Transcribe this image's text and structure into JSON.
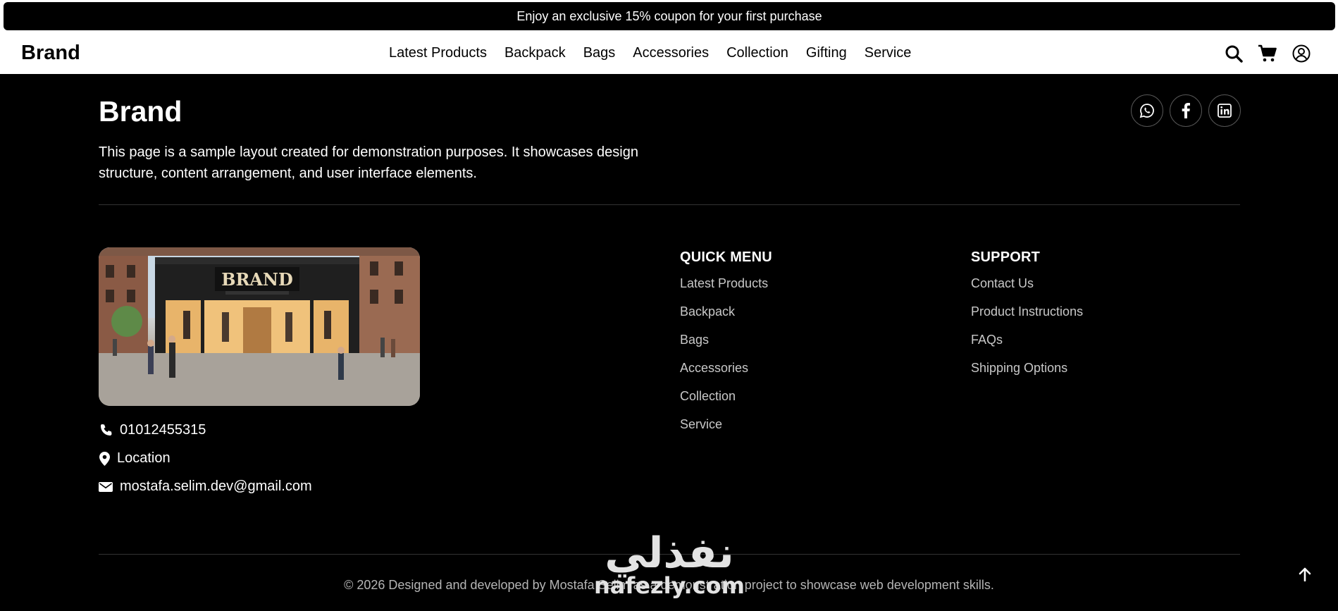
{
  "announcement": {
    "text": "Enjoy an exclusive 15% coupon for your first purchase"
  },
  "navbar": {
    "brand": "Brand",
    "links": [
      "Latest Products",
      "Backpack",
      "Bags",
      "Accessories",
      "Collection",
      "Gifting",
      "Service"
    ],
    "icons": [
      "search-icon",
      "cart-icon",
      "user-circle-icon"
    ]
  },
  "footer": {
    "brand": "Brand",
    "description": "This page is a sample layout created for demonstration purposes. It showcases design structure, content arrangement, and user interface elements.",
    "socials": [
      "whatsapp-icon",
      "facebook-icon",
      "linkedin-icon"
    ],
    "store_sign": "BRAND",
    "contact": {
      "phone": "01012455315",
      "location": "Location",
      "email": "mostafa.selim.dev@gmail.com"
    },
    "quick_menu": {
      "title": "QUICK MENU",
      "items": [
        "Latest Products",
        "Backpack",
        "Bags",
        "Accessories",
        "Collection",
        "Service"
      ]
    },
    "support": {
      "title": "SUPPORT",
      "items": [
        "Contact Us",
        "Product Instructions",
        "FAQs",
        "Shipping Options"
      ]
    },
    "copyright": "© 2026 Designed and developed by Mostafa Selim as a demonstration project to showcase web development skills."
  },
  "watermark": {
    "arabic": "نفذلي",
    "latin": "nafezly.com"
  },
  "colors": {
    "background": "#000000",
    "navbar": "#ffffff",
    "muted_link": "#c8c8c8"
  }
}
